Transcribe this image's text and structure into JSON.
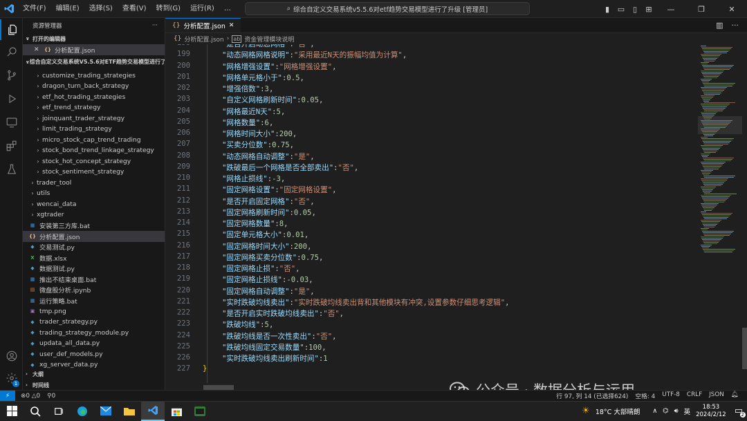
{
  "window": {
    "menus": [
      "文件(F)",
      "编辑(E)",
      "选择(S)",
      "查看(V)",
      "转到(G)",
      "运行(R)",
      "…"
    ],
    "command_center": "综合自定义交易系统v5.5.6对etf趋势交易模型进行了升级 [管理员]"
  },
  "sidebar": {
    "title": "资源管理器",
    "open_editors_label": "打开的编辑器",
    "open_editor_file": "分析配置.json",
    "project_label": "综合自定义交易系统V5.5.6对ETF趋势交易模型进行了...",
    "items": [
      {
        "name": "customize_trading_strategies",
        "type": "folder",
        "indent": 2
      },
      {
        "name": "dragon_turn_back_strategy",
        "type": "folder",
        "indent": 2
      },
      {
        "name": "etf_hot_trading_strategies",
        "type": "folder",
        "indent": 2
      },
      {
        "name": "etf_trend_strategy",
        "type": "folder",
        "indent": 2
      },
      {
        "name": "joinquant_trader_strategy",
        "type": "folder",
        "indent": 2
      },
      {
        "name": "limit_trading_strategy",
        "type": "folder",
        "indent": 2
      },
      {
        "name": "micro_stock_cap_trend_trading",
        "type": "folder",
        "indent": 2
      },
      {
        "name": "stock_bond_trend_linkage_strategy",
        "type": "folder",
        "indent": 2
      },
      {
        "name": "stock_hot_concept_strategy",
        "type": "folder",
        "indent": 2
      },
      {
        "name": "stock_sentiment_strategy",
        "type": "folder",
        "indent": 2
      },
      {
        "name": "trader_tool",
        "type": "folder",
        "indent": 1
      },
      {
        "name": "utils",
        "type": "folder",
        "indent": 1
      },
      {
        "name": "wencai_data",
        "type": "folder",
        "indent": 1
      },
      {
        "name": "xgtrader",
        "type": "folder",
        "indent": 1
      },
      {
        "name": "安装第三方库.bat",
        "type": "bat",
        "indent": 1
      },
      {
        "name": "分析配置.json",
        "type": "json",
        "indent": 1,
        "selected": true
      },
      {
        "name": "交易测试.py",
        "type": "py",
        "indent": 1
      },
      {
        "name": "数据.xlsx",
        "type": "xlsx",
        "indent": 1
      },
      {
        "name": "数据测试.py",
        "type": "py",
        "indent": 1
      },
      {
        "name": "推出不结束桌面.bat",
        "type": "bat",
        "indent": 1
      },
      {
        "name": "微盘股分析.ipynb",
        "type": "ipynb",
        "indent": 1
      },
      {
        "name": "运行策略.bat",
        "type": "bat",
        "indent": 1
      },
      {
        "name": "tmp.png",
        "type": "png",
        "indent": 1
      },
      {
        "name": "trader_strategy.py",
        "type": "py",
        "indent": 1
      },
      {
        "name": "trading_strategy_module.py",
        "type": "py",
        "indent": 1
      },
      {
        "name": "updata_all_data.py",
        "type": "py",
        "indent": 1
      },
      {
        "name": "user_def_models.py",
        "type": "py",
        "indent": 1
      },
      {
        "name": "xg_server_data.py",
        "type": "py",
        "indent": 1
      }
    ],
    "outline_label": "大纲",
    "timeline_label": "时间线"
  },
  "editor": {
    "tab_label": "分析配置.json",
    "breadcrumb": [
      "分析配置.json",
      "资金管理模块说明"
    ],
    "lines": [
      {
        "n": 198,
        "key": "是否开启动态网格",
        "val": "否",
        "vtype": "s",
        "partial": true
      },
      {
        "n": 199,
        "key": "动态网格网格说明",
        "val": "采用最近N天的振幅均值为计算",
        "vtype": "s"
      },
      {
        "n": 200,
        "key": "网格增强设置",
        "val": "网格增强设置",
        "vtype": "s"
      },
      {
        "n": 201,
        "key": "网格单元格小于",
        "val": "0.5",
        "vtype": "n"
      },
      {
        "n": 202,
        "key": "增强倍数",
        "val": "3",
        "vtype": "n"
      },
      {
        "n": 203,
        "key": "自定义网格刷新时间",
        "val": "0.05",
        "vtype": "n"
      },
      {
        "n": 204,
        "key": "网格最近N天",
        "val": "5",
        "vtype": "n"
      },
      {
        "n": 205,
        "key": "网格数量",
        "val": "6",
        "vtype": "n"
      },
      {
        "n": 206,
        "key": "网格时间大小",
        "val": "200",
        "vtype": "n"
      },
      {
        "n": 207,
        "key": "买卖分位数",
        "val": "0.75",
        "vtype": "n"
      },
      {
        "n": 208,
        "key": "动态网格自动调整",
        "val": "是",
        "vtype": "s"
      },
      {
        "n": 209,
        "key": "跌破最后一个网格是否全部卖出",
        "val": "否",
        "vtype": "s"
      },
      {
        "n": 210,
        "key": "网格止损线",
        "val": "-3",
        "vtype": "n"
      },
      {
        "n": 211,
        "key": "固定网格设置",
        "val": "固定网格设置",
        "vtype": "s"
      },
      {
        "n": 212,
        "key": "是否开启固定网格",
        "val": "否",
        "vtype": "s"
      },
      {
        "n": 213,
        "key": "固定网格刷新时间",
        "val": "0.05",
        "vtype": "n"
      },
      {
        "n": 214,
        "key": "固定网格数量",
        "val": "8",
        "vtype": "n"
      },
      {
        "n": 215,
        "key": "固定单元格大小",
        "val": "0.01",
        "vtype": "n"
      },
      {
        "n": 216,
        "key": "固定网格时间大小",
        "val": "200",
        "vtype": "n"
      },
      {
        "n": 217,
        "key": "固定网格买卖分位数",
        "val": "0.75",
        "vtype": "n"
      },
      {
        "n": 218,
        "key": "固定网格止损",
        "val": "否",
        "vtype": "s"
      },
      {
        "n": 219,
        "key": "固定网格止损线",
        "val": "-0.03",
        "vtype": "n"
      },
      {
        "n": 220,
        "key": "固定网格自动调整",
        "val": "是",
        "vtype": "s"
      },
      {
        "n": 221,
        "key": "实时跌破均线卖出",
        "val": "实时跌破均线卖出背和其他模块有冲突,设置参数仔细思考逻辑",
        "vtype": "s"
      },
      {
        "n": 222,
        "key": "是否开启实时跌破均线卖出",
        "val": "否",
        "vtype": "s"
      },
      {
        "n": 223,
        "key": "跌破均线",
        "val": "5",
        "vtype": "n"
      },
      {
        "n": 224,
        "key": "跌破均线是否一次性卖出",
        "val": "否",
        "vtype": "s"
      },
      {
        "n": 225,
        "key": "跌破均线固定交易数量",
        "val": "100",
        "vtype": "n"
      },
      {
        "n": 226,
        "key": "实时跌破均线卖出刷新时间",
        "val": "1",
        "vtype": "n",
        "last": true
      },
      {
        "n": 227,
        "closing": true
      }
    ]
  },
  "statusbar": {
    "errors": "0",
    "warnings": "0",
    "ports": "0",
    "position": "行 97, 列 14 (已选择624)",
    "spaces": "空格: 4",
    "encoding": "UTF-8",
    "eol": "CRLF",
    "language": "JSON"
  },
  "watermark": "公众号 · 数据分析与运用",
  "taskbar": {
    "weather": "18°C 大部晴朗",
    "ime": "英",
    "time": "18:53",
    "date": "2024/2/12",
    "notifications": "2"
  },
  "colors": {
    "accent": "#0078d4",
    "json_key": "#9cdcfe",
    "json_string": "#ce9178",
    "json_number": "#b5cea8"
  }
}
